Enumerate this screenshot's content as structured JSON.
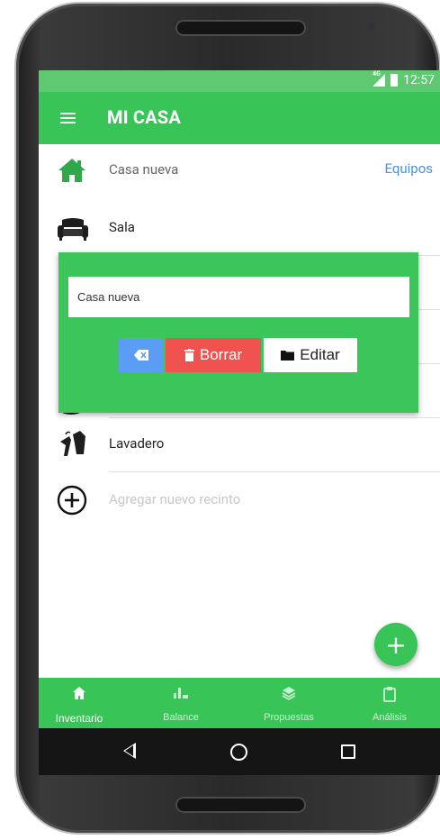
{
  "status_bar": {
    "network": "4G",
    "time": "12:57"
  },
  "app_bar": {
    "title": "MI CASA"
  },
  "list": {
    "house": {
      "name": "Casa nueva",
      "action": "Equipos"
    },
    "rooms": [
      {
        "label": "Sala",
        "icon": "sofa-icon"
      },
      {
        "label": "Lavadero",
        "icon": "laundry-icon"
      }
    ],
    "add_room": {
      "label": "Agregar nuevo recinto"
    }
  },
  "edit_dialog": {
    "input_value": "Casa nueva",
    "clear_label": "⌫",
    "delete_label": "Borrar",
    "edit_label": "Editar"
  },
  "fab": {
    "label": "+"
  },
  "bottom_nav": {
    "tabs": [
      {
        "label": "Inventario",
        "icon": "home-icon",
        "active": true
      },
      {
        "label": "Balance",
        "icon": "bar-chart-icon",
        "active": false
      },
      {
        "label": "Propuestas",
        "icon": "layers-icon",
        "active": false
      },
      {
        "label": "Análisis",
        "icon": "clipboard-icon",
        "active": false
      }
    ]
  },
  "colors": {
    "primary": "#39c457",
    "status_bar": "#5ec970",
    "delete": "#f0524f",
    "clear": "#5b9cf5",
    "link": "#4a90e2"
  }
}
